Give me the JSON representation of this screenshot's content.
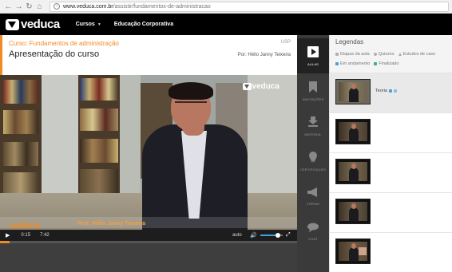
{
  "browser": {
    "url_domain": "www.veduca.com.br",
    "url_path": "/assistir/fundamentos-de-administracao",
    "back_icon": "back-arrow-icon",
    "forward_icon": "forward-arrow-icon",
    "reload_icon": "reload-icon",
    "home_icon": "home-icon"
  },
  "header": {
    "logo_text": "veduca",
    "menu": [
      {
        "label": "Cursos",
        "has_dropdown": true
      },
      {
        "label": "Educação Corporativa",
        "has_dropdown": false
      }
    ]
  },
  "course": {
    "title": "Curso: Fundamentos de administração",
    "institution": "USP",
    "lesson_title": "Apresentação do curso",
    "author": "Por: Hélio Janny Teixeira"
  },
  "video": {
    "watermark": "veduca",
    "lower_third_logo": "veduca",
    "lower_third_name": "Prof. Hélio Janny Teixeira",
    "current_time": "0:15",
    "total_time": "7:42",
    "progress": 0.032,
    "quality": "auto",
    "volume": 0.8
  },
  "side_menu": [
    {
      "label": "Aulas",
      "icon": "play-icon",
      "active": true
    },
    {
      "label": "Anotações",
      "icon": "bookmark-icon",
      "active": false
    },
    {
      "label": "Material",
      "icon": "download-icon",
      "active": false
    },
    {
      "label": "Certificação",
      "icon": "certificate-icon",
      "active": false
    },
    {
      "label": "Fórum",
      "icon": "megaphone-icon",
      "active": false
    },
    {
      "label": "Chat",
      "icon": "chat-icon",
      "active": false
    }
  ],
  "legend": {
    "title": "Legendas",
    "items_row1": [
      {
        "label": "Etapas da aula",
        "color": "#b0b0b0",
        "shape": "square"
      },
      {
        "label": "Quizzes",
        "color": "#b0b0b0",
        "shape": "circle"
      },
      {
        "label": "Estudos de caso",
        "color": "#b0b0b0",
        "shape": "triangle"
      }
    ],
    "items_row2": [
      {
        "label": "Em andamento",
        "color": "#3da5e0",
        "shape": "square"
      },
      {
        "label": "Finalizado",
        "color": "#3cb371",
        "shape": "square"
      }
    ]
  },
  "lessons": [
    {
      "label": "Teoria",
      "current": true,
      "status_colors": [
        "#3da5e0",
        "#9ab8d8"
      ]
    },
    {
      "label": "",
      "current": false,
      "status_colors": []
    },
    {
      "label": "",
      "current": false,
      "status_colors": []
    },
    {
      "label": "",
      "current": false,
      "status_colors": []
    },
    {
      "label": "",
      "current": false,
      "status_colors": []
    }
  ]
}
